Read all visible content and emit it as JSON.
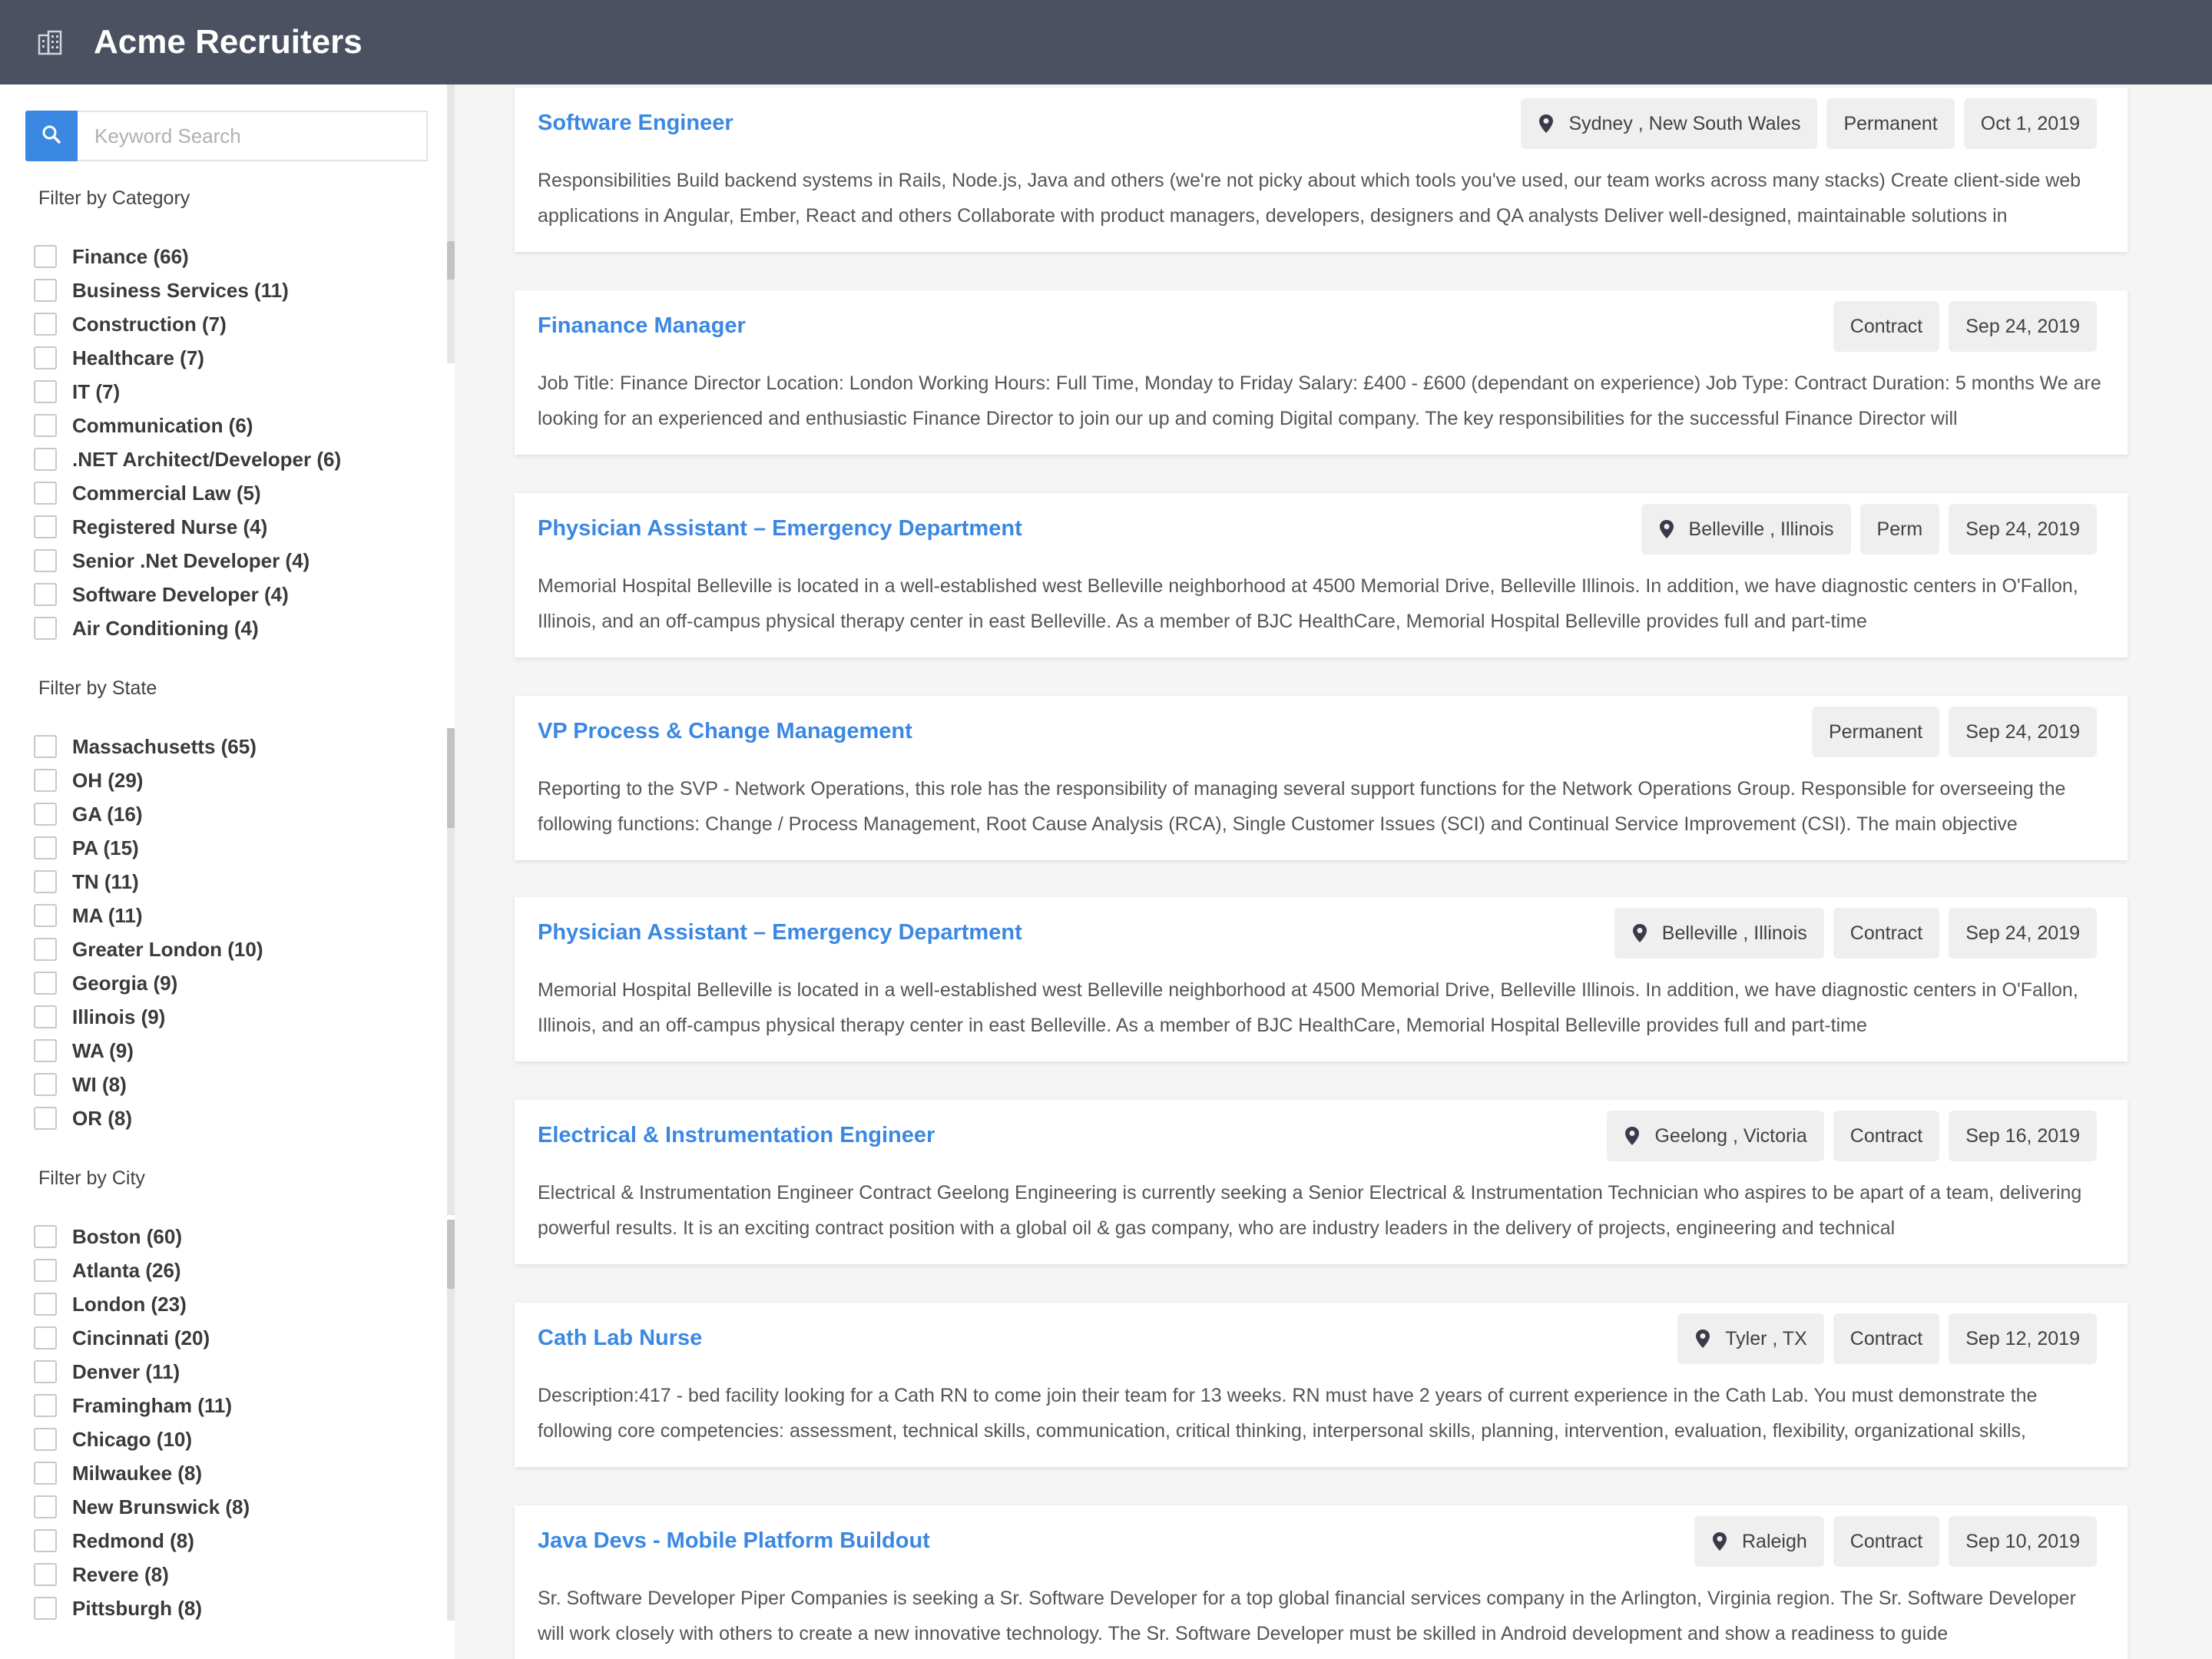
{
  "header": {
    "brand": "Acme Recruiters",
    "logo_icon": "building-icon"
  },
  "search": {
    "placeholder": "Keyword Search",
    "icon": "search-icon",
    "accent": "#3b88e3"
  },
  "filters": {
    "category": {
      "title": "Filter by Category",
      "items": [
        "Finance (66)",
        "Business Services (11)",
        "Construction (7)",
        "Healthcare (7)",
        "IT (7)",
        "Communication (6)",
        ".NET Architect/Developer (6)",
        "Commercial Law (5)",
        "Registered Nurse (4)",
        "Senior .Net Developer (4)",
        "Software Developer (4)",
        "Air Conditioning (4)"
      ]
    },
    "state": {
      "title": "Filter by State",
      "items": [
        "Massachusetts (65)",
        "OH (29)",
        "GA (16)",
        "PA (15)",
        "TN (11)",
        "MA (11)",
        "Greater London (10)",
        "Georgia (9)",
        "Illinois (9)",
        "WA (9)",
        "WI (8)",
        "OR (8)"
      ]
    },
    "city": {
      "title": "Filter by City",
      "items": [
        "Boston (60)",
        "Atlanta (26)",
        "London (23)",
        "Cincinnati (20)",
        "Denver (11)",
        "Framingham (11)",
        "Chicago (10)",
        "Milwaukee (8)",
        "New Brunswick (8)",
        "Redmond (8)",
        "Revere (8)",
        "Pittsburgh (8)"
      ]
    }
  },
  "jobs": [
    {
      "title": "Software Engineer",
      "location": "Sydney ,  New South Wales",
      "type": "Permanent",
      "date": "Oct 1, 2019",
      "description": "Responsibilities Build backend systems in Rails, Node.js, Java and others (we're not picky about which tools you've used, our team works across many stacks) Create client-side web applications in Angular, Ember, React and others Collaborate with product managers, developers, designers and QA analysts Deliver well-designed, maintainable solutions in"
    },
    {
      "title": "Finanance Manager",
      "location": null,
      "type": "Contract",
      "date": "Sep 24, 2019",
      "description": "Job Title: Finance Director Location: London Working Hours: Full Time, Monday to Friday Salary: £400 - £600 (dependant on experience) Job Type: Contract Duration: 5 months We are looking for an experienced and enthusiastic Finance Director to join our up and coming Digital company. The key responsibilities for the successful Finance Director will"
    },
    {
      "title": "Physician Assistant – Emergency Department",
      "location": "Belleville ,  Illinois",
      "type": "Perm",
      "date": "Sep 24, 2019",
      "description": "Memorial Hospital Belleville is located in a well-established west Belleville neighborhood at 4500 Memorial Drive, Belleville Illinois. In addition, we have diagnostic centers in O'Fallon, Illinois, and an off-campus physical therapy center in east Belleville. As a member of BJC HealthCare, Memorial Hospital Belleville provides full and part-time"
    },
    {
      "title": "VP Process & Change Management",
      "location": null,
      "type": "Permanent",
      "date": "Sep 24, 2019",
      "description": "Reporting to the SVP - Network Operations, this role has the responsibility of managing several support functions for the Network Operations Group. Responsible for overseeing the following functions: Change / Process Management, Root Cause Analysis (RCA), Single Customer Issues (SCI) and Continual Service Improvement (CSI). The main objective"
    },
    {
      "title": "Physician Assistant – Emergency Department",
      "location": "Belleville ,  Illinois",
      "type": "Contract",
      "date": "Sep 24, 2019",
      "description": "Memorial Hospital Belleville is located in a well-established west Belleville neighborhood at 4500 Memorial Drive, Belleville Illinois. In addition, we have diagnostic centers in O'Fallon, Illinois, and an off-campus physical therapy center in east Belleville. As a member of BJC HealthCare, Memorial Hospital Belleville provides full and part-time"
    },
    {
      "title": "Electrical & Instrumentation Engineer",
      "location": "Geelong ,  Victoria",
      "type": "Contract",
      "date": "Sep 16, 2019",
      "description": "Electrical & Instrumentation Engineer   Contract Geelong Engineering is currently seeking a Senior Electrical & Instrumentation Technician who aspires to be apart of a team, delivering powerful results. It is an exciting contract position with a global oil & gas company, who are industry leaders in the delivery of projects, engineering and technical"
    },
    {
      "title": "Cath Lab Nurse",
      "location": "Tyler ,  TX",
      "type": "Contract",
      "date": "Sep 12, 2019",
      "description": "Description:417 - bed facility looking for a Cath RN to come join their team for 13 weeks. RN must have 2 years of current experience in the Cath Lab. You must demonstrate the following core competencies: assessment, technical skills, communication, critical thinking, interpersonal skills, planning, intervention, evaluation, flexibility, organizational skills,"
    },
    {
      "title": "Java Devs - Mobile Platform Buildout",
      "location": "Raleigh",
      "type": "Contract",
      "date": "Sep 10, 2019",
      "description": "Sr. Software Developer Piper Companies is seeking a Sr. Software Developer for a top global financial services company in the Arlington, Virginia region. The Sr. Software Developer will work closely with others to create a new innovative technology. The Sr. Software Developer must be skilled in Android development and show a readiness to guide"
    }
  ]
}
